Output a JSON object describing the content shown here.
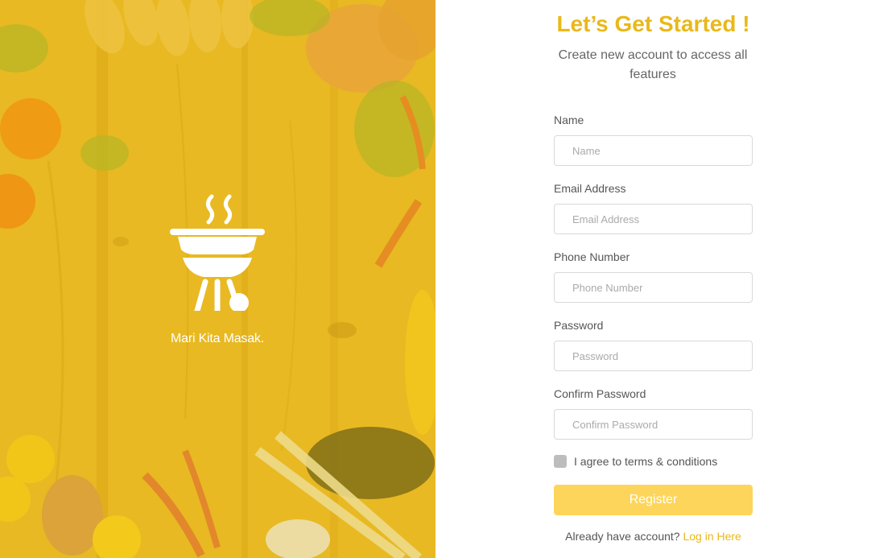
{
  "brand": {
    "logo_icon": "grill-icon",
    "tagline": "Mari Kita Masak."
  },
  "header": {
    "title": "Let’s Get Started !",
    "subtitle": "Create new account to access all features"
  },
  "form": {
    "fields": [
      {
        "label": "Name",
        "placeholder": "Name"
      },
      {
        "label": "Email Address",
        "placeholder": "Email Address"
      },
      {
        "label": "Phone Number",
        "placeholder": "Phone Number"
      },
      {
        "label": "Password",
        "placeholder": "Password"
      },
      {
        "label": "Confirm Password",
        "placeholder": "Confirm Password"
      }
    ],
    "terms_label": "I agree to terms & conditions",
    "register_label": "Register",
    "login_prompt": "Already have account?",
    "login_link": "Log in Here"
  },
  "colors": {
    "accent": "#e9b81a",
    "button": "#fdd55a",
    "overlay": "#e9bb1c"
  }
}
